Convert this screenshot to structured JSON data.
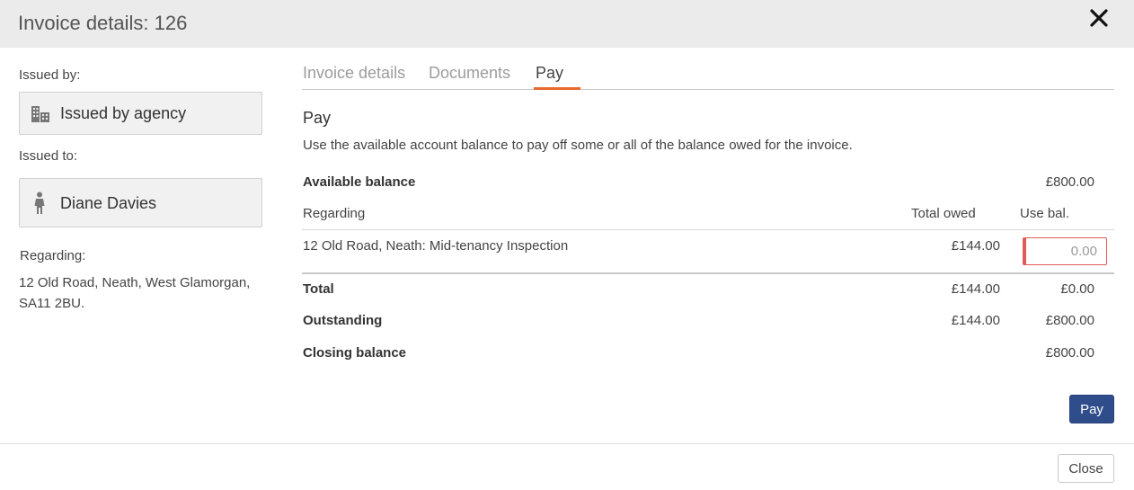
{
  "header": {
    "title": "Invoice details: 126"
  },
  "left": {
    "issued_by_label": "Issued by:",
    "issued_by": {
      "name": "Issued by agency",
      "icon": "building-icon"
    },
    "issued_to_label": "Issued to:",
    "issued_to": {
      "name": "Diane Davies",
      "icon": "person-icon"
    },
    "regarding_label": "Regarding:",
    "regarding_address": "12 Old Road, Neath, West Glamorgan, SA11 2BU."
  },
  "tabs": [
    {
      "label": "Invoice details",
      "active": false
    },
    {
      "label": "Documents",
      "active": false
    },
    {
      "label": "Pay",
      "active": true
    }
  ],
  "pay": {
    "title": "Pay",
    "description": "Use the available account balance to pay off some or all of the balance owed for the invoice.",
    "available_balance_label": "Available balance",
    "available_balance": "£800.00",
    "columns": {
      "regarding": "Regarding",
      "total_owed": "Total owed",
      "use_bal": "Use bal."
    },
    "rows": [
      {
        "regarding": "12 Old Road, Neath: Mid-tenancy Inspection",
        "total_owed": "£144.00",
        "use_bal_placeholder": "0.00"
      }
    ],
    "total": {
      "label": "Total",
      "owed": "£144.00",
      "use": "£0.00"
    },
    "outstanding": {
      "label": "Outstanding",
      "owed": "£144.00",
      "use": "£800.00"
    },
    "closing": {
      "label": "Closing balance",
      "use": "£800.00"
    },
    "pay_button": "Pay"
  },
  "footer": {
    "close_button": "Close"
  },
  "colors": {
    "accent": "#e8692a",
    "primary_button": "#2f4d8a",
    "error_border": "#e05a5a"
  }
}
